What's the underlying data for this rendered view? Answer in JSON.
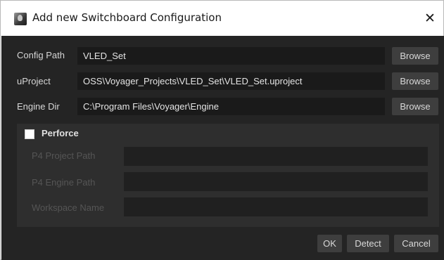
{
  "window": {
    "title": "Add new Switchboard Configuration",
    "close_glyph": "✕"
  },
  "rows": {
    "config_path": {
      "label": "Config Path",
      "value": "VLED_Set",
      "button": "Browse"
    },
    "uproject": {
      "label": "uProject",
      "value": "OSS\\Voyager_Projects\\VLED_Set\\VLED_Set.uproject",
      "button": "Browse"
    },
    "engine_dir": {
      "label": "Engine Dir",
      "value": "C:\\Program Files\\Voyager\\Engine",
      "button": "Browse"
    }
  },
  "perforce": {
    "label": "Perforce",
    "checked": false,
    "fields": {
      "project_path": {
        "label": "P4 Project Path",
        "value": ""
      },
      "engine_path": {
        "label": "P4 Engine Path",
        "value": ""
      },
      "workspace": {
        "label": "Workspace Name",
        "value": ""
      }
    }
  },
  "buttons": {
    "ok": "OK",
    "detect": "Detect",
    "cancel": "Cancel"
  },
  "icons": {
    "app": "switchboard-app-icon",
    "close": "close-icon"
  },
  "colors": {
    "background": "#242424",
    "field": "#1a1a1a",
    "button": "#3e3e3e",
    "panel": "#2e2e2e",
    "disabled_text": "#555555"
  }
}
